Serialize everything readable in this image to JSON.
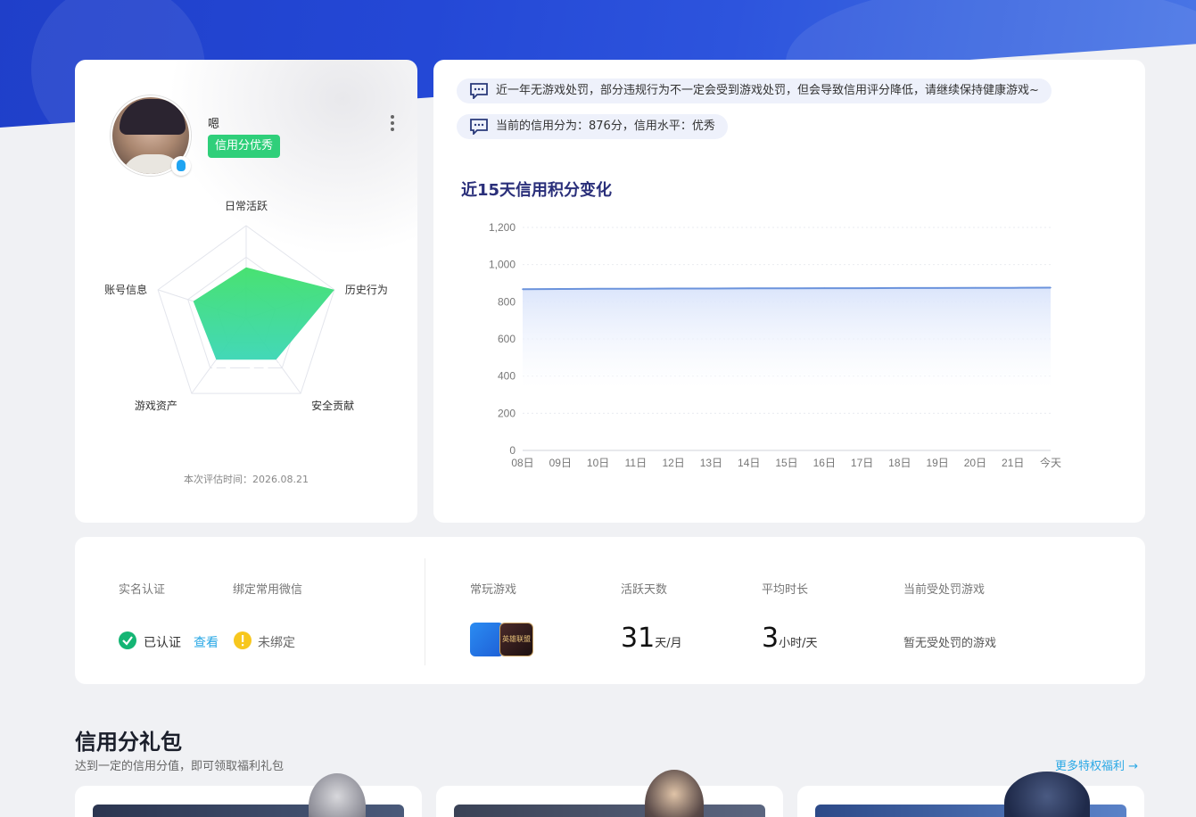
{
  "profile": {
    "username": "嗯",
    "credit_tag": "信用分优秀",
    "score": "876",
    "radar_labels": [
      "日常活跃",
      "历史行为",
      "安全贡献",
      "游戏资产",
      "账号信息"
    ],
    "radar_values": [
      0.55,
      1.0,
      0.55,
      0.55,
      0.6
    ],
    "eval_time": "本次评估时间：2026.08.21"
  },
  "notices": [
    "近一年无游戏处罚，部分违规行为不一定会受到游戏处罚，但会导致信用评分降低，请继续保持健康游戏~",
    "当前的信用分为：876分，信用水平：优秀"
  ],
  "chart_data": {
    "type": "area",
    "title": "近15天信用积分变化",
    "categories": [
      "08日",
      "09日",
      "10日",
      "11日",
      "12日",
      "13日",
      "14日",
      "15日",
      "16日",
      "17日",
      "18日",
      "19日",
      "20日",
      "21日",
      "今天"
    ],
    "values": [
      868,
      869,
      870,
      870,
      871,
      871,
      872,
      872,
      873,
      873,
      874,
      874,
      875,
      875,
      876
    ],
    "ylim": [
      0,
      1200
    ],
    "yticks": [
      "0",
      "200",
      "400",
      "600",
      "800",
      "1,000",
      "1,200"
    ],
    "grid": true,
    "colors": {
      "line": "#6b93dc",
      "fill": "#dbe5fb"
    }
  },
  "stats": {
    "realname_label": "实名认证",
    "wechat_label": "绑定常用微信",
    "realname_value": "已认证",
    "view_link": "查看",
    "wechat_value": "未绑定",
    "games_label": "常玩游戏",
    "game2_text": "英雄联盟",
    "active_label": "活跃天数",
    "active_num": "31",
    "active_unit": "天/月",
    "duration_label": "平均时长",
    "duration_num": "3",
    "duration_unit": "小时/天",
    "penalty_label": "当前受处罚游戏",
    "penalty_value": "暂无受处罚的游戏"
  },
  "gifts": {
    "title": "信用分礼包",
    "subtitle": "达到一定的信用分值，即可领取福利礼包",
    "more": "更多特权福利 →"
  }
}
